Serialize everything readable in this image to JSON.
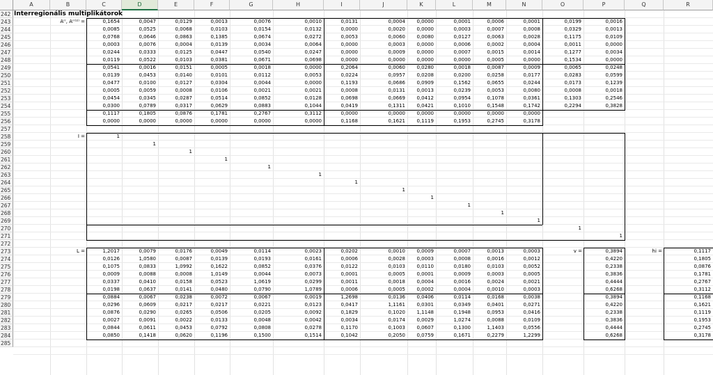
{
  "columns": [
    "A",
    "B",
    "C",
    "D",
    "E",
    "F",
    "G",
    "H",
    "I",
    "J",
    "K",
    "L",
    "M",
    "N",
    "O",
    "P",
    "Q",
    "R"
  ],
  "selected_column": "D",
  "first_row_number": 242,
  "last_row_number": 285,
  "title": "Interregionális multiplikátorok",
  "labels": {
    "a_matrix": "Aʳʳ, Aʳʳ⁽²⁾ =",
    "identity": "I =",
    "leontief": "L =",
    "v": "v =",
    "hi": "hi ="
  },
  "identity_value": "1",
  "a_block": [
    [
      "0,1654",
      "0,0047",
      "0,0129",
      "0,0013",
      "0,0076",
      "0,0010",
      "0,0131",
      "0,0004",
      "0,0000",
      "0,0001",
      "0,0006",
      "0,0001",
      "0,0199",
      "0,0016"
    ],
    [
      "0,0085",
      "0,0525",
      "0,0068",
      "0,0103",
      "0,0154",
      "0,0132",
      "0,0000",
      "0,0020",
      "0,0000",
      "0,0003",
      "0,0007",
      "0,0008",
      "0,0329",
      "0,0013"
    ],
    [
      "0,0768",
      "0,0646",
      "0,0863",
      "0,1385",
      "0,0674",
      "0,0272",
      "0,0053",
      "0,0060",
      "0,0080",
      "0,0127",
      "0,0063",
      "0,0028",
      "0,1175",
      "0,0109"
    ],
    [
      "0,0003",
      "0,0076",
      "0,0004",
      "0,0139",
      "0,0034",
      "0,0064",
      "0,0000",
      "0,0003",
      "0,0000",
      "0,0006",
      "0,0002",
      "0,0004",
      "0,0011",
      "0,0000"
    ],
    [
      "0,0244",
      "0,0333",
      "0,0125",
      "0,0447",
      "0,0540",
      "0,0247",
      "0,0000",
      "0,0009",
      "0,0000",
      "0,0007",
      "0,0015",
      "0,0014",
      "0,1277",
      "0,0034"
    ],
    [
      "0,0119",
      "0,0522",
      "0,0103",
      "0,0381",
      "0,0671",
      "0,0698",
      "0,0000",
      "0,0000",
      "0,0000",
      "0,0000",
      "0,0005",
      "0,0000",
      "0,1534",
      "0,0000"
    ],
    [
      "0,0541",
      "0,0016",
      "0,0151",
      "0,0005",
      "0,0018",
      "0,0000",
      "0,2064",
      "0,0060",
      "0,0280",
      "0,0018",
      "0,0087",
      "0,0009",
      "0,0065",
      "0,0248"
    ],
    [
      "0,0139",
      "0,0453",
      "0,0140",
      "0,0101",
      "0,0112",
      "0,0053",
      "0,0224",
      "0,0957",
      "0,0208",
      "0,0200",
      "0,0258",
      "0,0177",
      "0,0283",
      "0,0599"
    ],
    [
      "0,0477",
      "0,0100",
      "0,0127",
      "0,0304",
      "0,0044",
      "0,0000",
      "0,1193",
      "0,0686",
      "0,0909",
      "0,1562",
      "0,0655",
      "0,0244",
      "0,0173",
      "0,1239"
    ],
    [
      "0,0005",
      "0,0059",
      "0,0008",
      "0,0106",
      "0,0021",
      "0,0021",
      "0,0008",
      "0,0131",
      "0,0013",
      "0,0239",
      "0,0053",
      "0,0080",
      "0,0008",
      "0,0018"
    ],
    [
      "0,0454",
      "0,0345",
      "0,0287",
      "0,0514",
      "0,0852",
      "0,0128",
      "0,0698",
      "0,0669",
      "0,0412",
      "0,0954",
      "0,1078",
      "0,0361",
      "0,1303",
      "0,2546"
    ],
    [
      "0,0300",
      "0,0789",
      "0,0317",
      "0,0629",
      "0,0883",
      "0,1044",
      "0,0419",
      "0,1311",
      "0,0421",
      "0,1010",
      "0,1548",
      "0,1742",
      "0,2294",
      "0,3828"
    ],
    [
      "0,1117",
      "0,1805",
      "0,0876",
      "0,1781",
      "0,2767",
      "0,3112",
      "0,0000",
      "0,0000",
      "0,0000",
      "0,0000",
      "0,0000",
      "0,0000",
      "",
      ""
    ],
    [
      "0,0000",
      "0,0000",
      "0,0000",
      "0,0000",
      "0,0000",
      "0,0000",
      "0,1168",
      "0,1621",
      "0,1119",
      "0,1953",
      "0,2745",
      "0,3178",
      "",
      ""
    ]
  ],
  "l_block": [
    [
      "1,2017",
      "0,0079",
      "0,0176",
      "0,0049",
      "0,0114",
      "0,0023",
      "0,0202",
      "0,0010",
      "0,0009",
      "0,0007",
      "0,0013",
      "0,0003",
      "0,3894",
      "0,1117"
    ],
    [
      "0,0126",
      "1,0580",
      "0,0087",
      "0,0139",
      "0,0193",
      "0,0161",
      "0,0006",
      "0,0028",
      "0,0003",
      "0,0008",
      "0,0016",
      "0,0012",
      "0,4220",
      "0,1805"
    ],
    [
      "0,1075",
      "0,0833",
      "1,0992",
      "0,1622",
      "0,0852",
      "0,0376",
      "0,0122",
      "0,0103",
      "0,0110",
      "0,0180",
      "0,0103",
      "0,0052",
      "0,2338",
      "0,0876"
    ],
    [
      "0,0009",
      "0,0088",
      "0,0008",
      "1,0149",
      "0,0044",
      "0,0073",
      "0,0001",
      "0,0005",
      "0,0001",
      "0,0009",
      "0,0003",
      "0,0005",
      "0,3836",
      "0,1781"
    ],
    [
      "0,0337",
      "0,0410",
      "0,0158",
      "0,0523",
      "1,0619",
      "0,0299",
      "0,0011",
      "0,0018",
      "0,0004",
      "0,0016",
      "0,0024",
      "0,0021",
      "0,4444",
      "0,2767"
    ],
    [
      "0,0198",
      "0,0637",
      "0,0141",
      "0,0480",
      "0,0790",
      "1,0789",
      "0,0006",
      "0,0005",
      "0,0002",
      "0,0004",
      "0,0010",
      "0,0003",
      "0,6268",
      "0,3112"
    ],
    [
      "0,0884",
      "0,0067",
      "0,0238",
      "0,0072",
      "0,0067",
      "0,0019",
      "1,2698",
      "0,0136",
      "0,0406",
      "0,0114",
      "0,0168",
      "0,0038",
      "0,3894",
      "0,1168"
    ],
    [
      "0,0296",
      "0,0609",
      "0,0217",
      "0,0217",
      "0,0221",
      "0,0123",
      "0,0417",
      "1,1161",
      "0,0301",
      "0,0349",
      "0,0401",
      "0,0271",
      "0,4220",
      "0,1621"
    ],
    [
      "0,0876",
      "0,0290",
      "0,0265",
      "0,0506",
      "0,0205",
      "0,0092",
      "0,1829",
      "0,1020",
      "1,1148",
      "0,1948",
      "0,0953",
      "0,0416",
      "0,2338",
      "0,1119"
    ],
    [
      "0,0027",
      "0,0091",
      "0,0022",
      "0,0133",
      "0,0048",
      "0,0042",
      "0,0034",
      "0,0174",
      "0,0029",
      "1,0274",
      "0,0088",
      "0,0109",
      "0,3836",
      "0,1953"
    ],
    [
      "0,0844",
      "0,0611",
      "0,0453",
      "0,0792",
      "0,0808",
      "0,0278",
      "0,1170",
      "0,1003",
      "0,0607",
      "0,1300",
      "1,1403",
      "0,0556",
      "0,4444",
      "0,2745"
    ],
    [
      "0,0850",
      "0,1418",
      "0,0620",
      "0,1196",
      "0,1500",
      "0,1514",
      "0,1042",
      "0,2050",
      "0,0759",
      "0,1671",
      "0,2279",
      "1,2299",
      "0,6268",
      "0,3178"
    ]
  ]
}
